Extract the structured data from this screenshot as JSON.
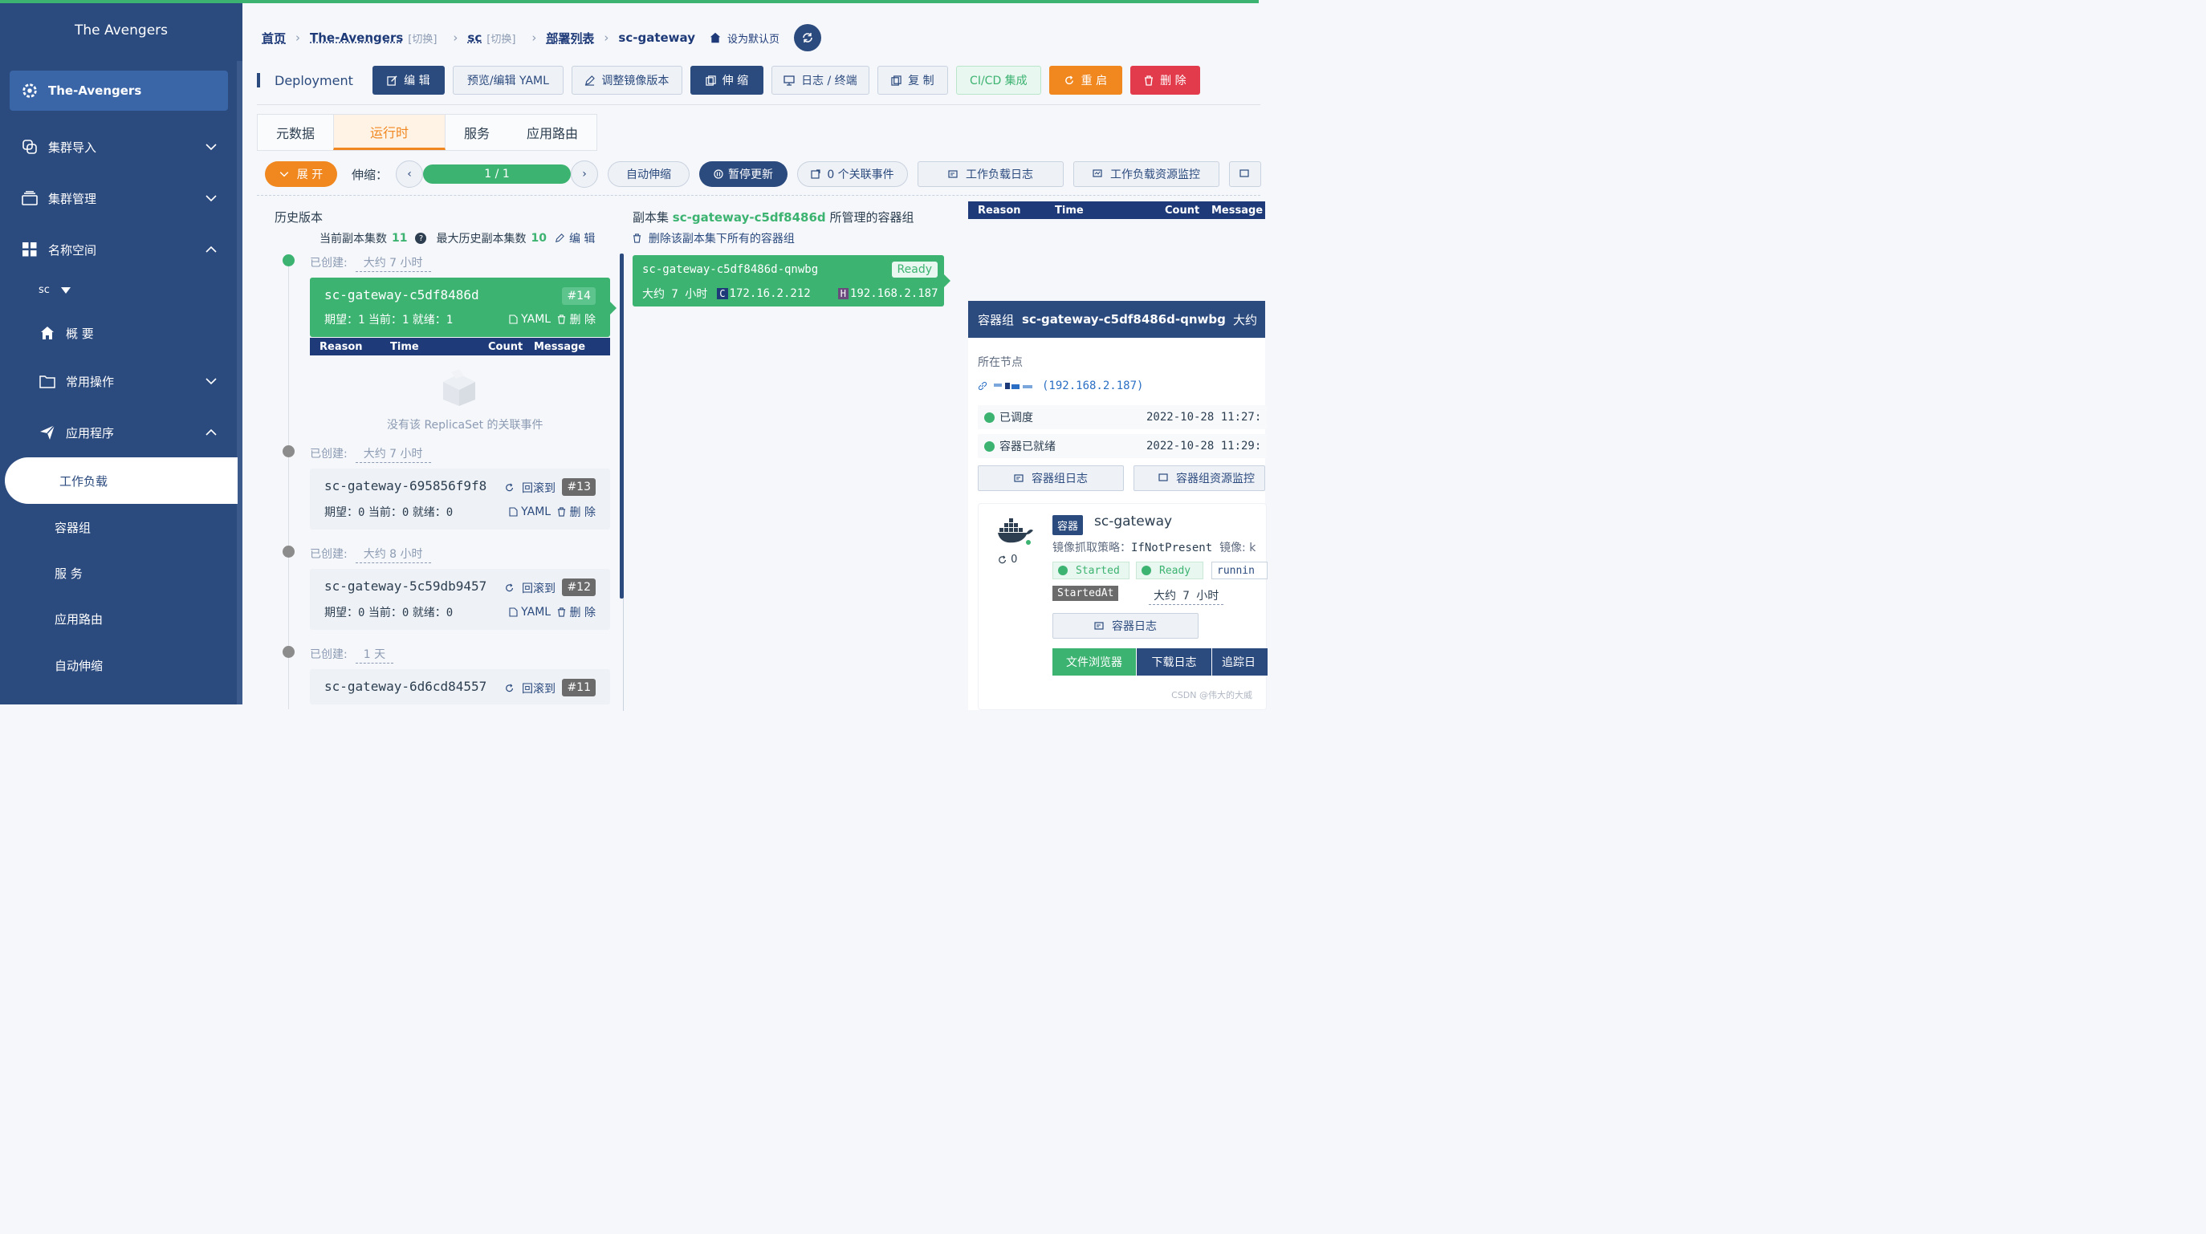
{
  "sidebar": {
    "title": "The Avengers",
    "active_cluster": "The-Avengers",
    "items": [
      {
        "label": "集群导入"
      },
      {
        "label": "集群管理"
      },
      {
        "label": "名称空间"
      }
    ],
    "namespace": "sc",
    "sub_items": [
      {
        "label": "概 要"
      },
      {
        "label": "常用操作"
      },
      {
        "label": "应用程序"
      }
    ],
    "app_items": [
      "工作负载",
      "容器组",
      "服 务",
      "应用路由",
      "自动伸缩"
    ]
  },
  "breadcrumb": {
    "home": "首页",
    "cluster": "The-Avengers",
    "switch1": "[切换]",
    "ns": "sc",
    "switch2": "[切换]",
    "list": "部署列表",
    "current": "sc-gateway",
    "default_label": "设为默认页"
  },
  "toolbar": {
    "kind": "Deployment",
    "edit": "编 辑",
    "yaml": "预览/编辑 YAML",
    "image": "调整镜像版本",
    "scale": "伸 缩",
    "logs": "日志 / 终端",
    "copy": "复 制",
    "cicd": "CI/CD 集成",
    "restart": "重 启",
    "delete": "删 除"
  },
  "tabs": [
    "元数据",
    "运行时",
    "服务",
    "应用路由"
  ],
  "controls": {
    "expand": "展 开",
    "scale_label": "伸缩：",
    "replicas": "1 / 1",
    "autoscale": "自动伸缩",
    "pause": "暂停更新",
    "events": "0 个关联事件",
    "workload_logs": "工作负载日志",
    "monitor": "工作负载资源监控"
  },
  "history": {
    "title": "历史版本",
    "current_label": "当前副本集数",
    "current_count": "11",
    "max_label": "最大历史副本集数",
    "max_count": "10",
    "edit": "编 辑",
    "created_label": "已创建:",
    "rollback": "回滚到",
    "yaml": "YAML",
    "delete": "删 除",
    "empty": "没有该 ReplicaSet 的关联事件",
    "event_cols": [
      "Reason",
      "Time",
      "Count",
      "Message"
    ],
    "replicasets": [
      {
        "name": "sc-gateway-c5df8486d",
        "rev": "#14",
        "age": "大约 7 小时",
        "desired": "1",
        "current": "1",
        "ready": "1"
      },
      {
        "name": "sc-gateway-695856f9f8",
        "rev": "#13",
        "age": "大约 7 小时",
        "desired": "0",
        "current": "0",
        "ready": "0"
      },
      {
        "name": "sc-gateway-5c59db9457",
        "rev": "#12",
        "age": "大约 8 小时",
        "desired": "0",
        "current": "0",
        "ready": "0"
      },
      {
        "name": "sc-gateway-6d6cd84557",
        "rev": "#11",
        "age": "1 天"
      }
    ],
    "meta_labels": {
      "desired": "期望：",
      "current": "当前：",
      "ready": "就绪："
    }
  },
  "replicaset_panel": {
    "prefix": "副本集",
    "name": "sc-gateway-c5df8486d",
    "suffix": "所管理的容器组",
    "delete_all": "删除该副本集下所有的容器组",
    "pod": {
      "name": "sc-gateway-c5df8486d-qnwbg",
      "status": "Ready",
      "age": "大约 7 小时",
      "cluster_ip": "172.16.2.212",
      "host_ip": "192.168.2.187",
      "c_tag": "C",
      "h_tag": "H"
    }
  },
  "pod_panel": {
    "event_cols": [
      "Reason",
      "Time",
      "Count",
      "Message"
    ],
    "label": "容器组",
    "name": "sc-gateway-c5df8486d-qnwbg",
    "age_prefix": "大约",
    "node_label": "所在节点",
    "node_value": "(192.168.2.187)",
    "conditions": [
      {
        "label": "已调度",
        "time": "2022-10-28 11:27:"
      },
      {
        "label": "容器已就绪",
        "time": "2022-10-28 11:29:"
      }
    ],
    "pod_logs": "容器组日志",
    "pod_monitor": "容器组资源监控",
    "container": {
      "tag": "容器",
      "name": "sc-gateway",
      "policy_label": "镜像抓取策略：",
      "policy": "IfNotPresent",
      "image_label": "镜像: k",
      "restarts": "0",
      "started": "Started",
      "ready": "Ready",
      "running": "runnin",
      "startedat_label": "StartedAt",
      "startedat": "大约 7 小时",
      "logs": "容器日志",
      "file_browser": "文件浏览器",
      "download": "下载日志",
      "follow": "追踪日"
    }
  },
  "watermark": "CSDN @伟大的大威",
  "colors": {
    "navy": "#2b4a7e",
    "green": "#3cb371",
    "orange": "#f0871f",
    "red": "#e23b4b"
  }
}
